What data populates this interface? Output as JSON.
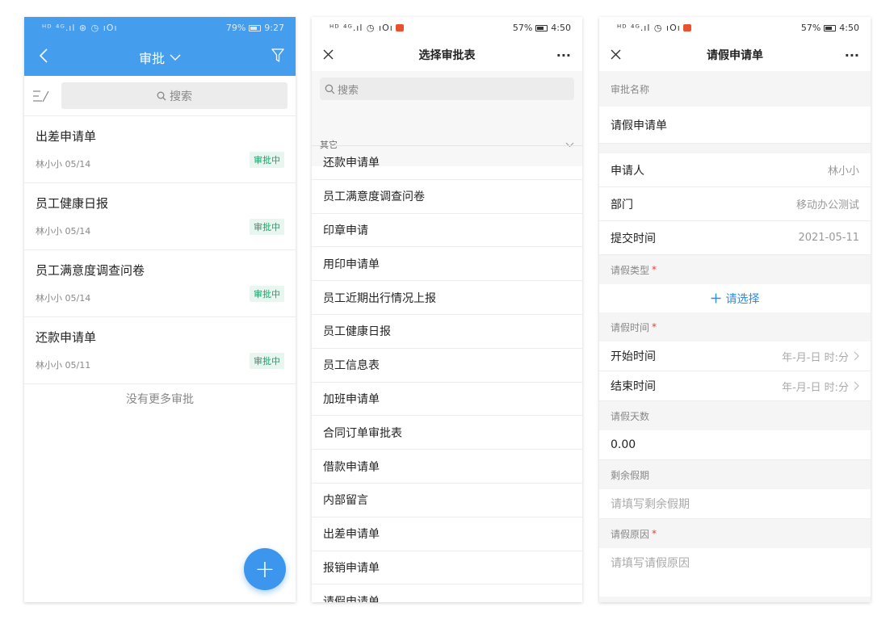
{
  "screen1": {
    "status": {
      "left": "ᴴᴰ ⁴ᴳ.ıl ⊛ ◷ ıОı",
      "battery": "79%",
      "time": "9:27"
    },
    "nav": {
      "title": "审批"
    },
    "search": {
      "placeholder": "搜索"
    },
    "items": [
      {
        "title": "出差申请单",
        "meta": "林小小  05/14",
        "badge": "审批中"
      },
      {
        "title": "员工健康日报",
        "meta": "林小小  05/14",
        "badge": "审批中"
      },
      {
        "title": "员工满意度调查问卷",
        "meta": "林小小  05/14",
        "badge": "审批中"
      },
      {
        "title": "还款申请单",
        "meta": "林小小  05/11",
        "badge": "审批中"
      }
    ],
    "no_more": "没有更多审批",
    "fab": "+"
  },
  "screen2": {
    "status": {
      "left": "ᴴᴰ ⁴ᴳ.ıl ◷ ıОı",
      "battery": "57%",
      "time": "4:50"
    },
    "nav": {
      "title": "选择审批表",
      "more": "···"
    },
    "search": {
      "placeholder": "搜索"
    },
    "group": "其它",
    "forms": [
      "还款申请单",
      "员工满意度调查问卷",
      "印章申请",
      "用印申请单",
      "员工近期出行情况上报",
      "员工健康日报",
      "员工信息表",
      "加班申请单",
      "合同订单审批表",
      "借款申请单",
      "内部留言",
      "出差申请单",
      "报销申请单",
      "请假申请单"
    ]
  },
  "screen3": {
    "status": {
      "left": "ᴴᴰ ⁴ᴳ.ıl ◷ ıОı",
      "battery": "57%",
      "time": "4:50"
    },
    "nav": {
      "title": "请假申请单",
      "more": "···"
    },
    "approval_name_label": "审批名称",
    "approval_name_value": "请假申请单",
    "applicant_label": "申请人",
    "applicant_value": "林小小",
    "dept_label": "部门",
    "dept_value": "移动办公测试",
    "submit_time_label": "提交时间",
    "submit_time_value": "2021-05-11",
    "leave_type_label": "请假类型",
    "leave_type_action": "请选择",
    "leave_time_label": "请假时间",
    "start_label": "开始时间",
    "start_placeholder": "年-月-日 时:分",
    "end_label": "结束时间",
    "end_placeholder": "年-月-日 时:分",
    "days_label": "请假天数",
    "days_value": "0.00",
    "remaining_label": "剩余假期",
    "remaining_placeholder": "请填写剩余假期",
    "reason_label": "请假原因",
    "reason_placeholder": "请填写请假原因",
    "required_mark": "*"
  },
  "colors": {
    "header_blue": "#459ded",
    "fab_blue": "#3d96ee",
    "badge_green": "#1aa36a",
    "link_blue": "#2b8ee8",
    "required_red": "#e5433a"
  }
}
